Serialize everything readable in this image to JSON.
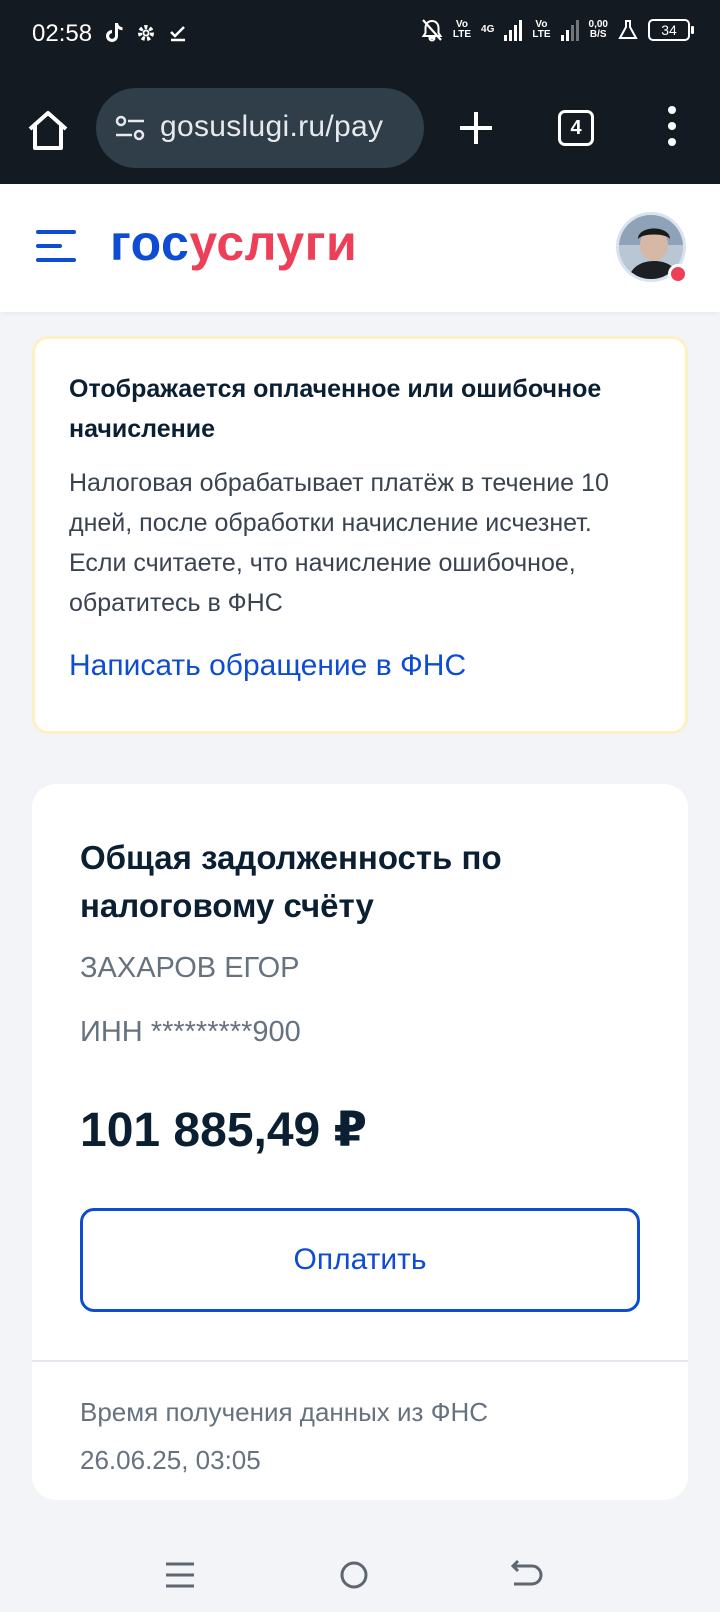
{
  "status_bar": {
    "time": "02:58",
    "volte1": "Vo\nLTE",
    "net4g": "4G",
    "volte2": "Vo\nLTE",
    "speed": "0,00\nB/S",
    "battery": "34"
  },
  "browser": {
    "url": "gosuslugi.ru/pay",
    "tab_count": "4"
  },
  "header": {
    "logo_part1": "гос",
    "logo_part2": "услуги",
    "brand_colors": {
      "blue": "#0d4cd3",
      "red": "#ee3f58"
    }
  },
  "alert": {
    "title": "Отображается оплаченное или ошибочное начисление",
    "text": "Налоговая обрабатывает платёж в течение 10 дней, после обработки начисление исчезнет. Если считаете, что начисление ошибочное, обратитесь в ФНС",
    "link": "Написать обращение в ФНС"
  },
  "debt_card": {
    "title": "Общая задолженность по налоговому счёту",
    "name": "ЗАХАРОВ ЕГОР",
    "inn": "ИНН *********900",
    "amount": "101 885,49 ₽",
    "pay_button": "Оплатить",
    "footer_label": "Время получения данных из ФНС",
    "footer_time": "26.06.25, 03:05"
  }
}
